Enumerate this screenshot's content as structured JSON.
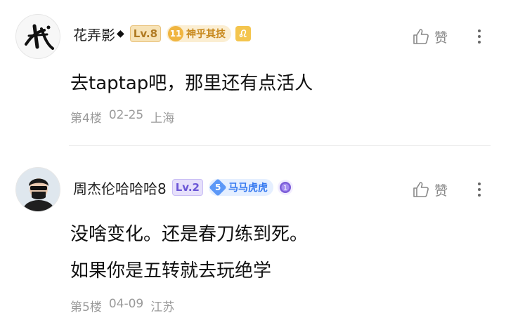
{
  "comments": [
    {
      "username": "花弄影",
      "diamond": "◆",
      "level": "Lv.8",
      "fan_badge_num": "11",
      "fan_badge_text": "神乎其技",
      "extra_badge_icon": "leo-zodiac-icon",
      "like_label": "赞",
      "content_lines": [
        "去taptap吧，那里还有点活人"
      ],
      "floor": "第4楼",
      "date": "02-25",
      "location": "上海"
    },
    {
      "username": "周杰伦哈哈哈8",
      "level": "Lv.2",
      "fan_badge_num": "5",
      "fan_badge_text": "马马虎虎",
      "extra_badge_icon": "medal-icon",
      "like_label": "赞",
      "content_lines": [
        "没啥变化。还是春刀练到死。",
        "如果你是五转就去玩绝学"
      ],
      "floor": "第5楼",
      "date": "04-09",
      "location": "江苏"
    }
  ],
  "colors": {
    "level_gold": "#b07a22",
    "level_purple": "#6b56d6",
    "fan_gold": "#c8891d",
    "fan_blue": "#3478f0",
    "meta_gray": "#9a9a9a"
  }
}
